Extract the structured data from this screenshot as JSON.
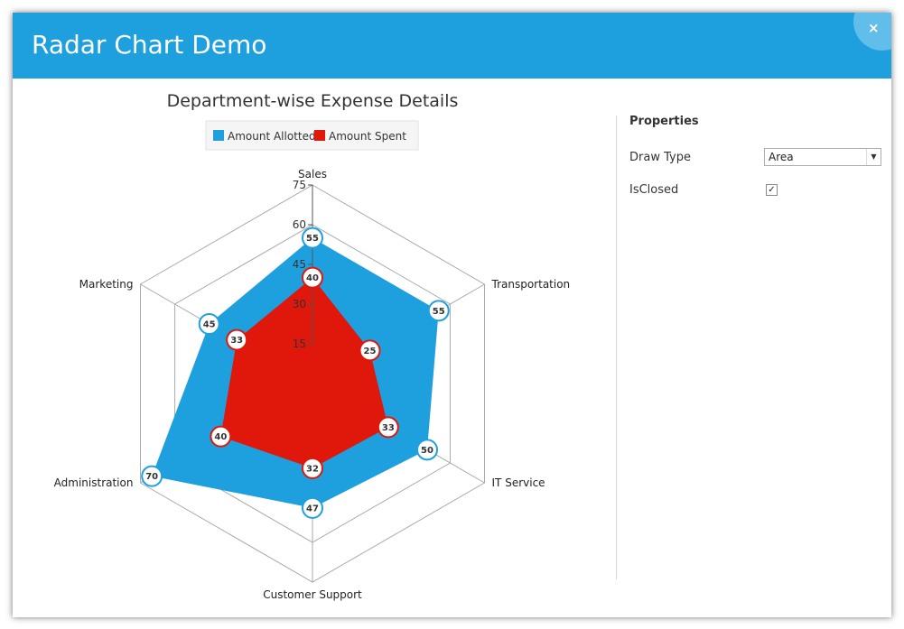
{
  "window": {
    "title": "Radar Chart Demo",
    "close_glyph": "×",
    "accent_color": "#1fa0de"
  },
  "properties": {
    "title": "Properties",
    "draw_type_label": "Draw Type",
    "draw_type_value": "Area",
    "is_closed_label": "IsClosed",
    "is_closed_checked": true,
    "check_glyph": "✓"
  },
  "chart_data": {
    "type": "radar",
    "title": "Department-wise Expense Details",
    "categories": [
      "Sales",
      "Transportation",
      "IT Service",
      "Customer Support",
      "Administration",
      "Marketing"
    ],
    "rlim": [
      0,
      75
    ],
    "ticks": [
      15,
      30,
      45,
      60,
      75
    ],
    "legend_position": "top",
    "series": [
      {
        "name": "Amount Allotted",
        "color": "#1fa0de",
        "values": [
          55,
          55,
          50,
          47,
          70,
          45
        ]
      },
      {
        "name": "Amount Spent",
        "color": "#e0170b",
        "values": [
          40,
          25,
          33,
          32,
          40,
          33
        ]
      }
    ]
  }
}
